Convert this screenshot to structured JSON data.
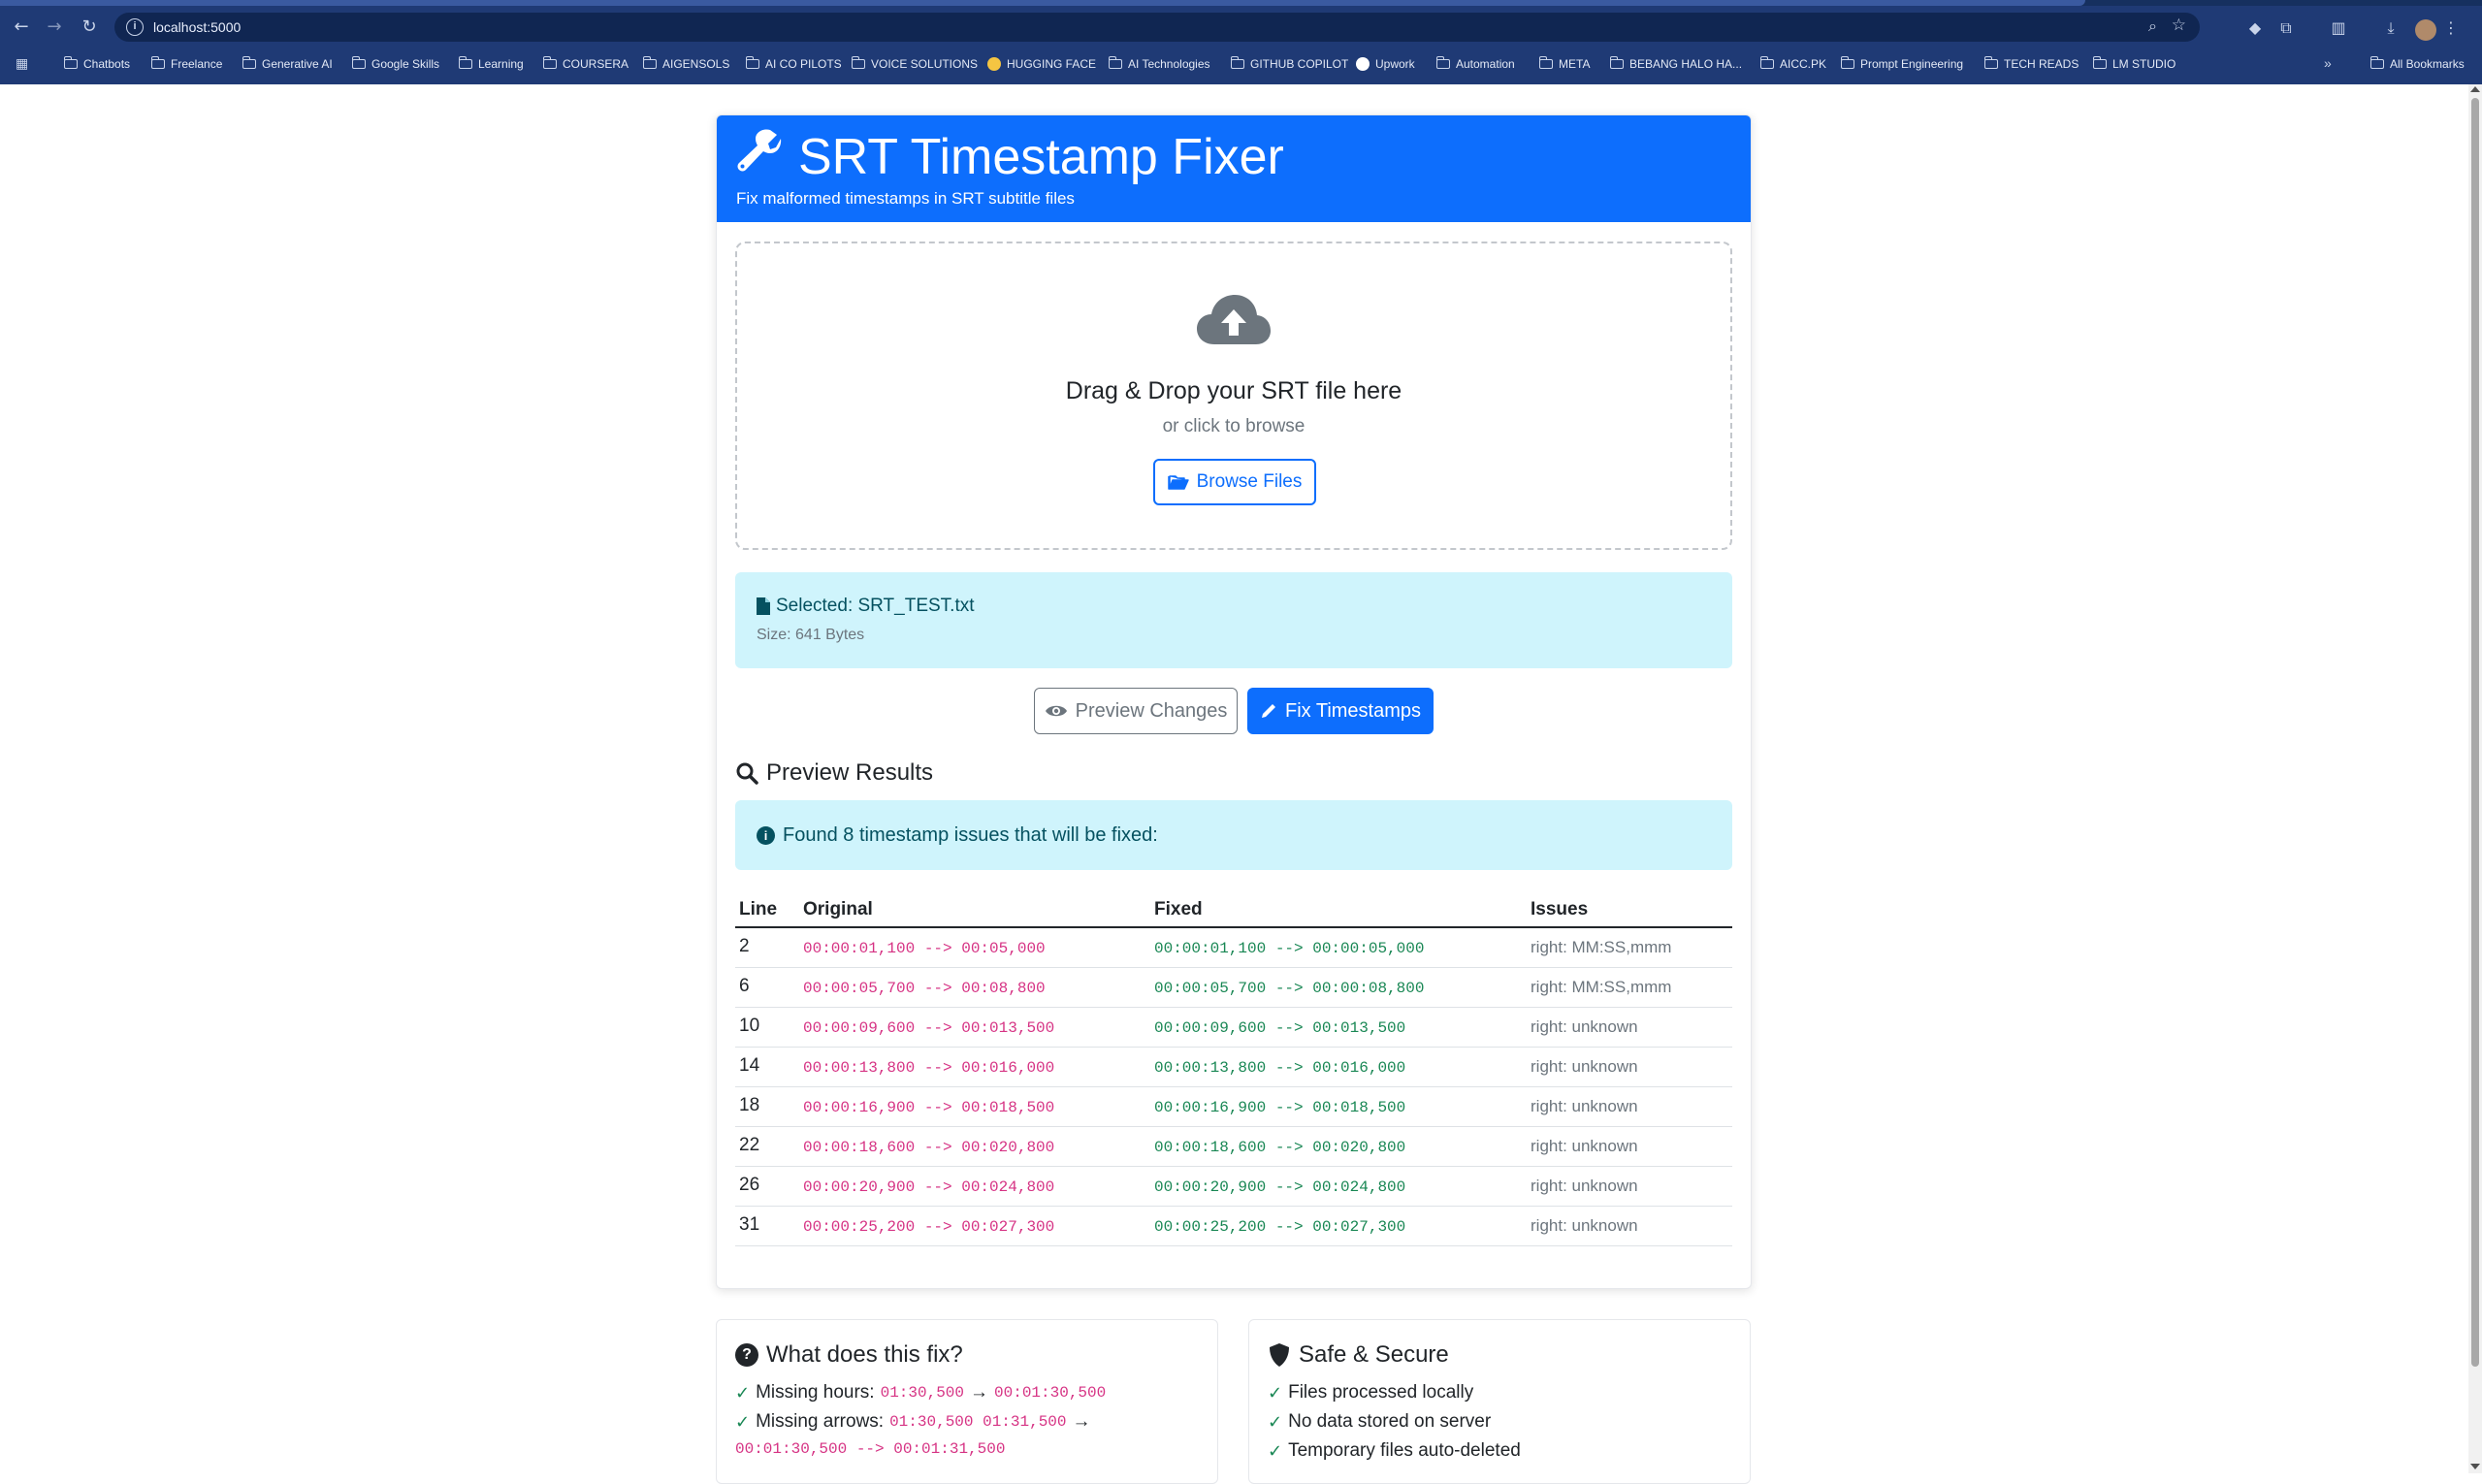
{
  "browser": {
    "url": "localhost:5000",
    "bookmarks": [
      "Chatbots",
      "Freelance",
      "Generative AI",
      "Google Skills",
      "Learning",
      "COURSERA",
      "AIGENSOLS",
      "AI CO PILOTS",
      "VOICE SOLUTIONS",
      "HUGGING FACE",
      "AI Technologies",
      "GITHUB COPILOT",
      "Upwork",
      "Automation",
      "META",
      "BEBANG HALO HA...",
      "AICC.PK",
      "Prompt Engineering",
      "TECH READS",
      "LM STUDIO"
    ],
    "all_bookmarks": "All Bookmarks",
    "more": "»"
  },
  "header": {
    "title": "SRT Timestamp Fixer",
    "subtitle": "Fix malformed timestamps in SRT subtitle files"
  },
  "dropzone": {
    "title": "Drag & Drop your SRT file here",
    "hint": "or click to browse",
    "browse_label": "Browse Files"
  },
  "file": {
    "selected": "Selected: SRT_TEST.txt",
    "size": "Size: 641 Bytes"
  },
  "actions": {
    "preview_label": "Preview Changes",
    "fix_label": "Fix Timestamps"
  },
  "results": {
    "title": "Preview Results",
    "found": "Found 8 timestamp issues that will be fixed:",
    "columns": [
      "Line",
      "Original",
      "Fixed",
      "Issues"
    ],
    "rows": [
      {
        "line": "2",
        "original": "00:00:01,100 --> 00:05,000",
        "fixed": "00:00:01,100 --> 00:00:05,000",
        "issue": "right: MM:SS,mmm"
      },
      {
        "line": "6",
        "original": "00:00:05,700 --> 00:08,800",
        "fixed": "00:00:05,700 --> 00:00:08,800",
        "issue": "right: MM:SS,mmm"
      },
      {
        "line": "10",
        "original": "00:00:09,600 --> 00:013,500",
        "fixed": "00:00:09,600 --> 00:013,500",
        "issue": "right: unknown"
      },
      {
        "line": "14",
        "original": "00:00:13,800 --> 00:016,000",
        "fixed": "00:00:13,800 --> 00:016,000",
        "issue": "right: unknown"
      },
      {
        "line": "18",
        "original": "00:00:16,900 --> 00:018,500",
        "fixed": "00:00:16,900 --> 00:018,500",
        "issue": "right: unknown"
      },
      {
        "line": "22",
        "original": "00:00:18,600 --> 00:020,800",
        "fixed": "00:00:18,600 --> 00:020,800",
        "issue": "right: unknown"
      },
      {
        "line": "26",
        "original": "00:00:20,900 --> 00:024,800",
        "fixed": "00:00:20,900 --> 00:024,800",
        "issue": "right: unknown"
      },
      {
        "line": "31",
        "original": "00:00:25,200 --> 00:027,300",
        "fixed": "00:00:25,200 --> 00:027,300",
        "issue": "right: unknown"
      }
    ]
  },
  "what": {
    "title": "What does this fix?",
    "missing_hours_label": "Missing hours:",
    "missing_hours_from": "01:30,500",
    "missing_hours_to": "00:01:30,500",
    "missing_arrows_label": "Missing arrows:",
    "missing_arrows_from": "01:30,500 01:31,500",
    "missing_arrows_to": "00:01:30,500 --> 00:01:31,500",
    "arrow": "→"
  },
  "safe": {
    "title": "Safe & Secure",
    "items": [
      "Files processed locally",
      "No data stored on server",
      "Temporary files auto-deleted"
    ]
  },
  "colors": {
    "primary": "#0d6efd",
    "info_bg": "#cff4fc",
    "code_pink": "#d63384",
    "success": "#198754"
  }
}
